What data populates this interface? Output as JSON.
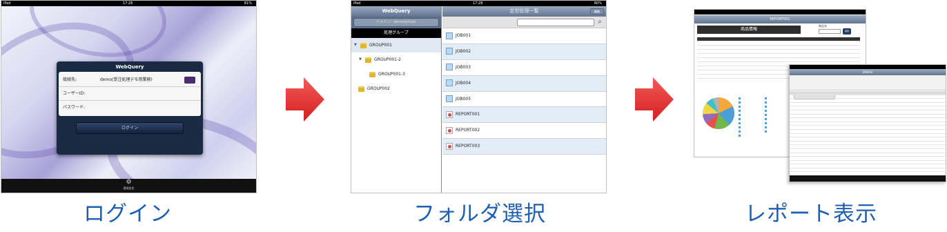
{
  "steps": [
    {
      "caption": "ログイン"
    },
    {
      "caption": "フォルダ選択"
    },
    {
      "caption": "レポート表示"
    }
  ],
  "colors": {
    "caption": "#1d5fb2",
    "arrow": "#e52a2a",
    "ipad_nav": "#62748f",
    "dialog": "#1b2a43"
  },
  "login_screen": {
    "statusbar": {
      "carrier": "iPad",
      "time": "17:26",
      "battery": "81%"
    },
    "dialog_title": "WebQuery",
    "fields": [
      {
        "label": "接続先:",
        "value": "demo(受注処理デモ用業務)"
      },
      {
        "label": "ユーザーID:",
        "value": ""
      },
      {
        "label": "パスワード:",
        "value": ""
      }
    ],
    "login_button": "ログイン",
    "settings_label": "環境設定"
  },
  "folder_screen": {
    "statusbar": {
      "carrier": "iPad",
      "time": "17:28",
      "battery": "80%"
    },
    "left_title": "WebQuery",
    "domain_button": "ドメイン：demodomain",
    "group_header": "処理グループ",
    "right_title": "定型処理一覧",
    "edit_button": "編集",
    "search_placeholder": "",
    "tree": [
      {
        "label": "GROUP001"
      },
      {
        "label": "GROUP001-2"
      },
      {
        "label": "GROUP001-3"
      },
      {
        "label": "GROUP002"
      }
    ],
    "files": [
      {
        "label": "JOB001",
        "kind": "job"
      },
      {
        "label": "JOB002",
        "kind": "job"
      },
      {
        "label": "JOB003",
        "kind": "job"
      },
      {
        "label": "JOB004",
        "kind": "job"
      },
      {
        "label": "JOB005",
        "kind": "job"
      },
      {
        "label": "REPORT001",
        "kind": "report"
      },
      {
        "label": "REPORT002",
        "kind": "report"
      },
      {
        "label": "REPORT003",
        "kind": "report"
      }
    ]
  },
  "report_screen": {
    "title": "REPORT001",
    "heading": "商品情報",
    "product_name_label": "商品名",
    "search_button": "検索",
    "second_title": "JOB002"
  }
}
